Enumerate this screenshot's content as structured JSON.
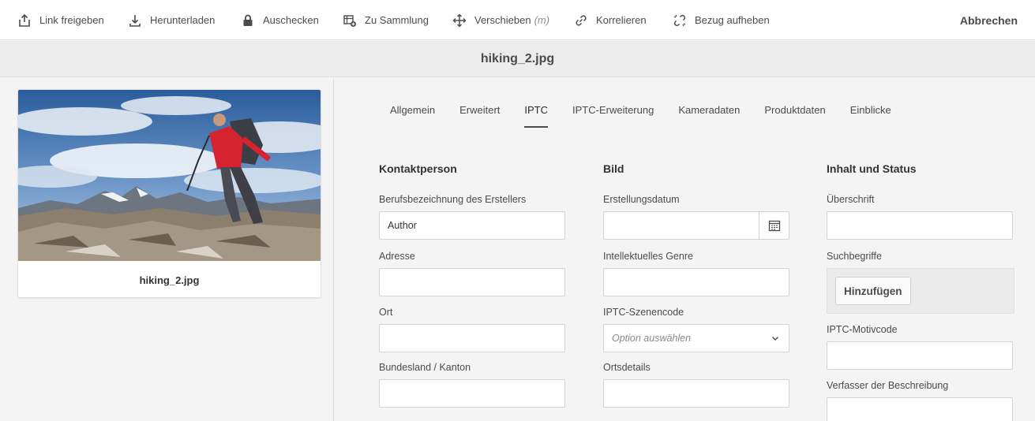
{
  "toolbar": {
    "items": [
      {
        "label": "Link freigeben",
        "icon": "share-link-icon"
      },
      {
        "label": "Herunterladen",
        "icon": "download-icon"
      },
      {
        "label": "Auschecken",
        "icon": "lock-icon"
      },
      {
        "label": "Zu Sammlung",
        "icon": "add-to-collection-icon"
      },
      {
        "label": "Verschieben",
        "hint": "(m)",
        "icon": "move-icon"
      },
      {
        "label": "Korrelieren",
        "icon": "link-icon"
      },
      {
        "label": "Bezug aufheben",
        "icon": "unlink-icon"
      }
    ],
    "cancel_label": "Abbrechen"
  },
  "title": "hiking_2.jpg",
  "preview": {
    "caption": "hiking_2.jpg"
  },
  "tabs": [
    {
      "label": "Allgemein",
      "active": false
    },
    {
      "label": "Erweitert",
      "active": false
    },
    {
      "label": "IPTC",
      "active": true
    },
    {
      "label": "IPTC-Erweiterung",
      "active": false
    },
    {
      "label": "Kameradaten",
      "active": false
    },
    {
      "label": "Produktdaten",
      "active": false
    },
    {
      "label": "Einblicke",
      "active": false
    }
  ],
  "form": {
    "contact": {
      "title": "Kontaktperson",
      "job_title_label": "Berufsbezeichnung des Erstellers",
      "job_title_value": "Author",
      "address_label": "Adresse",
      "city_label": "Ort",
      "state_label": "Bundesland / Kanton"
    },
    "image": {
      "title": "Bild",
      "date_label": "Erstellungsdatum",
      "genre_label": "Intellektuelles Genre",
      "scene_label": "IPTC-Szenencode",
      "scene_placeholder": "Option auswählen",
      "location_label": "Ortsdetails"
    },
    "content": {
      "title": "Inhalt und Status",
      "headline_label": "Überschrift",
      "keywords_label": "Suchbegriffe",
      "keywords_button": "Hinzufügen",
      "subject_label": "IPTC-Motivcode",
      "writer_label": "Verfasser der Beschreibung"
    }
  },
  "colors": {
    "accent": "#4b4b4b",
    "toolbar_bg": "#ffffff",
    "page_bg": "#f4f4f4"
  }
}
